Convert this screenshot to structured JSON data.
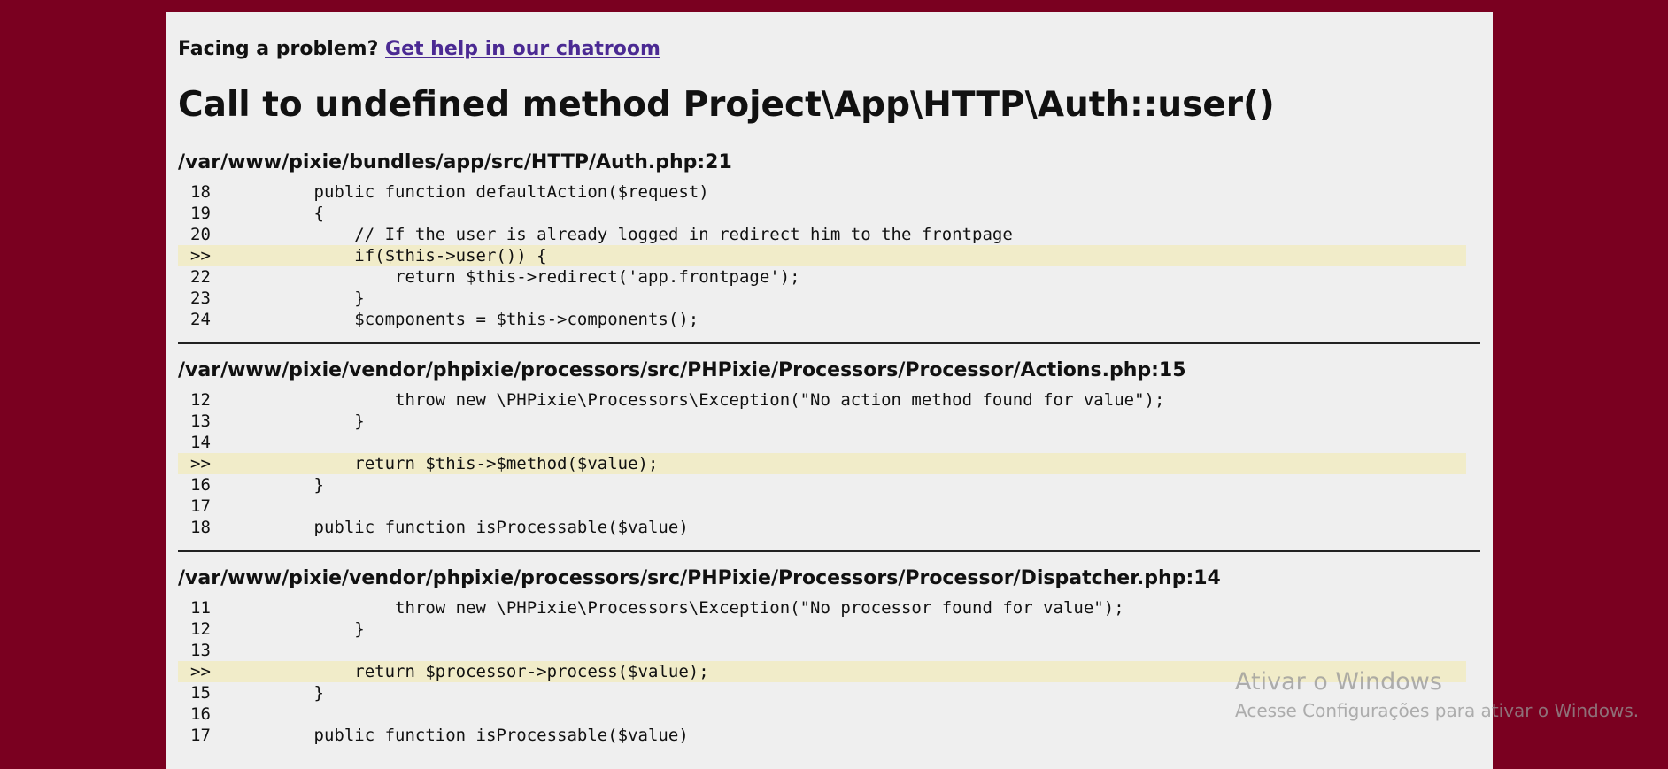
{
  "help": {
    "prefix": "Facing a problem?",
    "link_label": "Get help in our chatroom"
  },
  "error_title": "Call to undefined method Project\\App\\HTTP\\Auth::user()",
  "traces": [
    {
      "file": "/var/www/pixie/bundles/app/src/HTTP/Auth.php:21",
      "lines": [
        {
          "num": "18",
          "code": "        public function defaultAction($request)",
          "highlight": false
        },
        {
          "num": "19",
          "code": "        {",
          "highlight": false
        },
        {
          "num": "20",
          "code": "            // If the user is already logged in redirect him to the frontpage",
          "highlight": false
        },
        {
          "num": ">>",
          "code": "            if($this->user()) {",
          "highlight": true
        },
        {
          "num": "22",
          "code": "                return $this->redirect('app.frontpage');",
          "highlight": false
        },
        {
          "num": "23",
          "code": "            }",
          "highlight": false
        },
        {
          "num": "24",
          "code": "            $components = $this->components();",
          "highlight": false
        }
      ]
    },
    {
      "file": "/var/www/pixie/vendor/phpixie/processors/src/PHPixie/Processors/Processor/Actions.php:15",
      "lines": [
        {
          "num": "12",
          "code": "                throw new \\PHPixie\\Processors\\Exception(\"No action method found for value\");",
          "highlight": false
        },
        {
          "num": "13",
          "code": "            }",
          "highlight": false
        },
        {
          "num": "14",
          "code": "",
          "highlight": false
        },
        {
          "num": ">>",
          "code": "            return $this->$method($value);",
          "highlight": true
        },
        {
          "num": "16",
          "code": "        }",
          "highlight": false
        },
        {
          "num": "17",
          "code": "",
          "highlight": false
        },
        {
          "num": "18",
          "code": "        public function isProcessable($value)",
          "highlight": false
        }
      ]
    },
    {
      "file": "/var/www/pixie/vendor/phpixie/processors/src/PHPixie/Processors/Processor/Dispatcher.php:14",
      "lines": [
        {
          "num": "11",
          "code": "                throw new \\PHPixie\\Processors\\Exception(\"No processor found for value\");",
          "highlight": false
        },
        {
          "num": "12",
          "code": "            }",
          "highlight": false
        },
        {
          "num": "13",
          "code": "",
          "highlight": false
        },
        {
          "num": ">>",
          "code": "            return $processor->process($value);",
          "highlight": true
        },
        {
          "num": "15",
          "code": "        }",
          "highlight": false
        },
        {
          "num": "16",
          "code": "",
          "highlight": false
        },
        {
          "num": "17",
          "code": "        public function isProcessable($value)",
          "highlight": false
        }
      ]
    }
  ],
  "watermark": {
    "title": "Ativar o Windows",
    "subtitle": "Acesse Configurações para ativar o Windows."
  },
  "colors": {
    "background": "#7a0020",
    "panel": "#efefef",
    "highlight": "#f1ecc9",
    "link": "#4b2a93"
  }
}
